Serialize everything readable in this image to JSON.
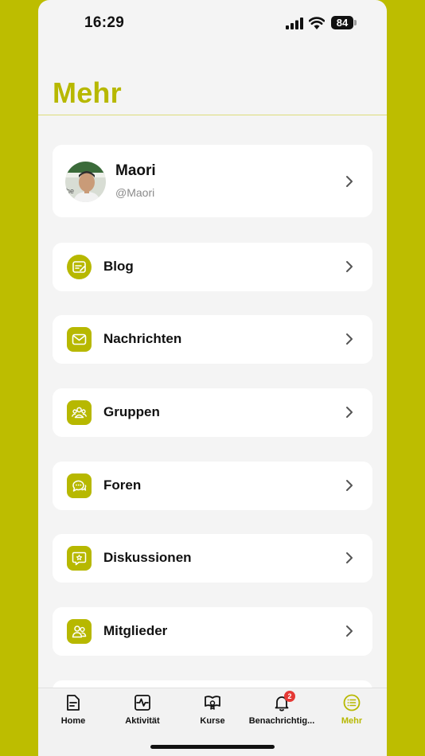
{
  "status_bar": {
    "time": "16:29",
    "battery": "84"
  },
  "header": {
    "title": "Mehr"
  },
  "profile": {
    "name": "Maori",
    "handle": "@Maori"
  },
  "menu": [
    {
      "label": "Blog",
      "icon": "blog-icon"
    },
    {
      "label": "Nachrichten",
      "icon": "envelope-icon"
    },
    {
      "label": "Gruppen",
      "icon": "groups-icon"
    },
    {
      "label": "Foren",
      "icon": "chat-bubbles-icon"
    },
    {
      "label": "Diskussionen",
      "icon": "discussion-icon"
    },
    {
      "label": "Mitglieder",
      "icon": "members-icon"
    }
  ],
  "tabs": [
    {
      "label": "Home",
      "icon": "document-icon",
      "active": false
    },
    {
      "label": "Aktivität",
      "icon": "activity-icon",
      "active": false
    },
    {
      "label": "Kurse",
      "icon": "course-icon",
      "active": false
    },
    {
      "label": "Benachrichtig...",
      "icon": "bell-icon",
      "active": false,
      "badge": "2"
    },
    {
      "label": "Mehr",
      "icon": "list-icon",
      "active": true
    }
  ],
  "colors": {
    "accent": "#B7B800",
    "background": "#BDBD00",
    "badge": "#E53935"
  }
}
